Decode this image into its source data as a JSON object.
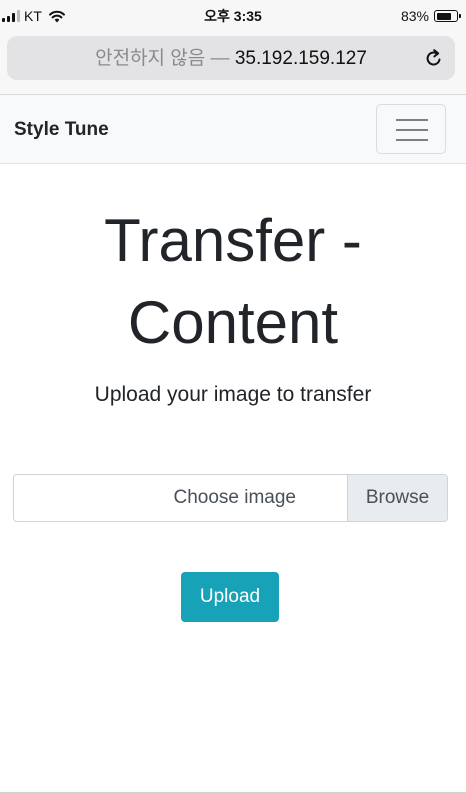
{
  "status_bar": {
    "carrier": "KT",
    "time": "오후 3:35",
    "battery_percent": "83%",
    "battery_level": 0.83,
    "icons": [
      "signal-icon",
      "wifi-icon",
      "battery-icon"
    ]
  },
  "browser": {
    "security_label": "안전하지 않음",
    "separator": "—",
    "host": "35.192.159.127",
    "reload_icon": "reload-icon"
  },
  "navbar": {
    "brand": "Style Tune",
    "toggler_icon": "hamburger-menu-icon"
  },
  "main": {
    "heading_line1": "Transfer -",
    "heading_line2": "Content",
    "lead": "Upload your image to transfer",
    "file_input": {
      "label": "Choose image",
      "browse_label": "Browse"
    },
    "upload_label": "Upload"
  },
  "colors": {
    "primary_button": "#17a2b8",
    "navbar_bg": "#f8f9fa",
    "browse_bg": "#e9ecef"
  }
}
